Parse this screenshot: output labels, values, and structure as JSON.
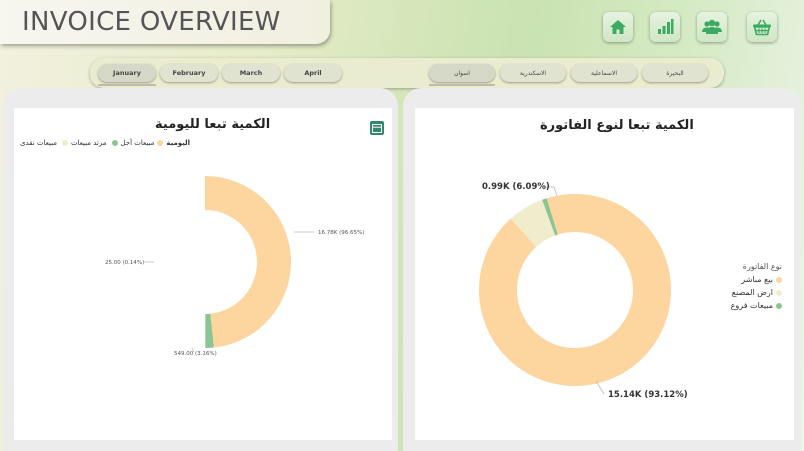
{
  "header": {
    "title": "INVOICE OVERVIEW",
    "nav_icons": [
      "home-icon",
      "bar-chart-icon",
      "users-icon",
      "basket-icon"
    ]
  },
  "filters": {
    "months": [
      "January",
      "February",
      "March",
      "April"
    ],
    "months_selected": "January",
    "regions": [
      "اسوان",
      "الاسكندرية",
      "الاسماعلية",
      "البحيرة"
    ],
    "regions_selected": "اسوان"
  },
  "colors": {
    "peach": "#fdd59f",
    "cream": "#f0edcd",
    "green": "#8cc594",
    "icon_green": "#3caa63"
  },
  "left_chart": {
    "title": "الكمية تبعا لليومية",
    "legend_title": "اليومية",
    "table_icon": "table-icon"
  },
  "right_chart": {
    "title": "الكمية تبعا لنوع الفاتورة",
    "legend_title": "نوع الفاتورة"
  },
  "chart_data": [
    {
      "type": "pie",
      "subtype": "half-donut",
      "title": "الكمية تبعا لليومية",
      "legend_title": "اليومية",
      "legend_position": "top-left",
      "series": [
        {
          "name": "مبيعات أجل",
          "value": 16780,
          "label": "16.78K (96.65%)",
          "color": "#fdd59f"
        },
        {
          "name": "مرتد مبيعات",
          "value": 549,
          "label": "549.00 (3.16%)",
          "color": "#8cc594"
        },
        {
          "name": "مبيعات نقدى",
          "value": 25,
          "label": "25.00 (0.14%)",
          "color": "#f0edcd"
        }
      ]
    },
    {
      "type": "pie",
      "subtype": "donut",
      "title": "الكمية تبعا لنوع الفاتورة",
      "legend_title": "نوع الفاتورة",
      "legend_position": "right",
      "series": [
        {
          "name": "بيع مباشر",
          "value": 15140,
          "label": "15.14K (93.12%)",
          "color": "#fdd59f"
        },
        {
          "name": "ارض المصنع",
          "value": 990,
          "label": "0.99K (6.09%)",
          "color": "#f0edcd"
        },
        {
          "name": "مبيعات فروع",
          "value": 128,
          "label": "",
          "color": "#8cc594"
        }
      ]
    }
  ]
}
